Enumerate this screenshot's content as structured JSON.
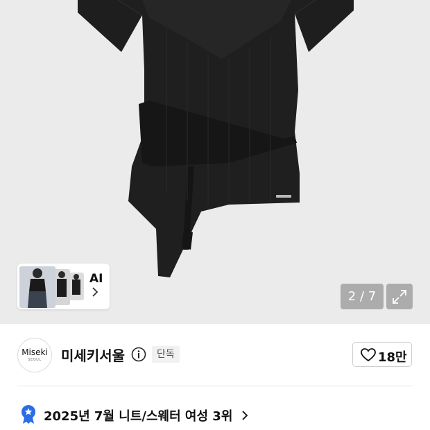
{
  "gallery": {
    "image_alt": "black ribbed asymmetric wrap bodysuit top",
    "ai_label": "AI",
    "counter": "2 / 7"
  },
  "brand": {
    "logo_main": "Miseki",
    "logo_sub": "SEOUL",
    "name": "미세키서울",
    "badge": "단독",
    "like_count": "18만"
  },
  "ranking": {
    "text": "2025년 7월 니트/스웨터 여성 3위"
  },
  "colors": {
    "gallery_bg": "#ebebeb",
    "medal_blue": "#2b6de8",
    "garment": "#1c1c1c"
  }
}
